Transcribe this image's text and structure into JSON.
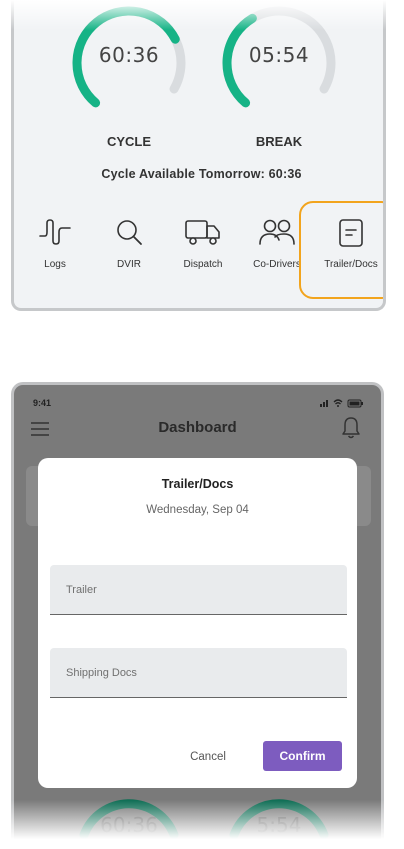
{
  "top_screen": {
    "gauges": [
      {
        "value": "60:36",
        "label": "CYCLE",
        "fraction": 0.78,
        "color": "#16b386"
      },
      {
        "value": "05:54",
        "label": "BREAK",
        "fraction": 0.42,
        "color": "#16b386"
      }
    ],
    "cycle_available": "Cycle Available Tomorrow: 60:36",
    "nav": [
      {
        "label": "Logs",
        "icon": "logs-icon"
      },
      {
        "label": "DVIR",
        "icon": "search-icon"
      },
      {
        "label": "Dispatch",
        "icon": "truck-icon"
      },
      {
        "label": "Co-Drivers",
        "icon": "people-icon"
      },
      {
        "label": "Trailer/Docs",
        "icon": "document-icon"
      }
    ],
    "highlight_color": "#f2a41d"
  },
  "bottom_screen": {
    "status_time": "9:41",
    "header_title": "Dashboard",
    "bottom_gauge_values": [
      "60:36",
      "5:54"
    ],
    "dialog": {
      "title": "Trailer/Docs",
      "date": "Wednesday, Sep 04",
      "trailer_placeholder": "Trailer",
      "shipping_placeholder": "Shipping Docs",
      "cancel_label": "Cancel",
      "confirm_label": "Confirm",
      "confirm_color": "#7d5cbf"
    }
  }
}
